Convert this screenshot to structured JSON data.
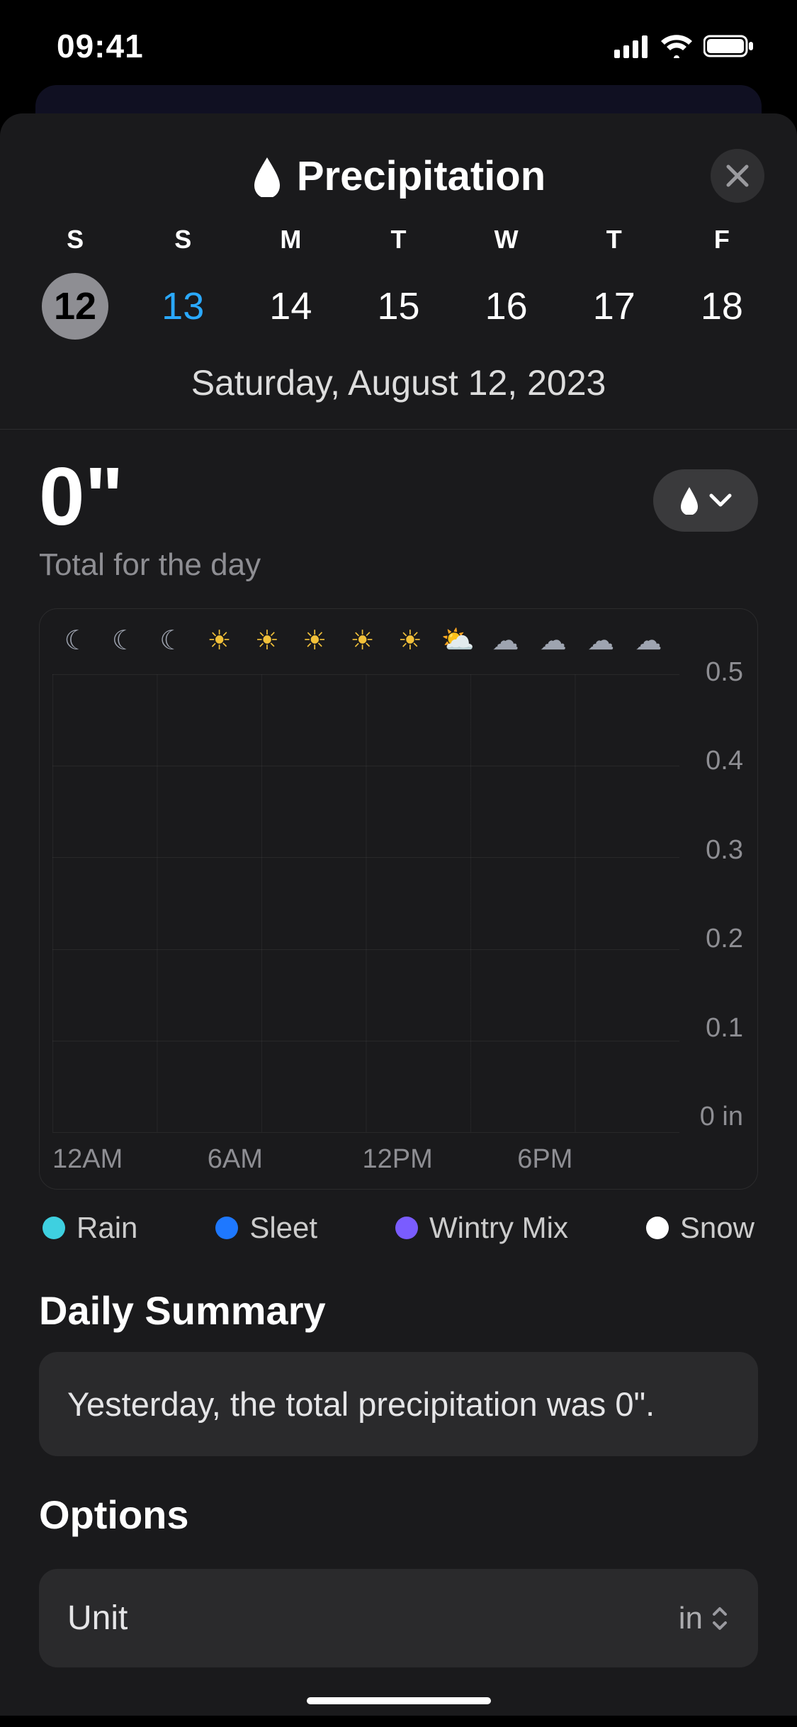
{
  "status": {
    "time": "09:41"
  },
  "header": {
    "title": "Precipitation"
  },
  "calendar": {
    "dow": [
      "S",
      "S",
      "M",
      "T",
      "W",
      "T",
      "F"
    ],
    "dates": [
      "12",
      "13",
      "14",
      "15",
      "16",
      "17",
      "18"
    ],
    "full_date": "Saturday, August 12, 2023"
  },
  "total": {
    "value": "0\"",
    "label": "Total for the day"
  },
  "chart_data": {
    "type": "bar",
    "x_hours": [
      0,
      1,
      2,
      3,
      4,
      5,
      6,
      7,
      8,
      9,
      10,
      11,
      12,
      13,
      14,
      15,
      16,
      17,
      18,
      19,
      20,
      21,
      22,
      23
    ],
    "values": [
      0,
      0,
      0,
      0,
      0,
      0,
      0,
      0,
      0,
      0,
      0,
      0,
      0,
      0,
      0,
      0,
      0,
      0,
      0,
      0,
      0,
      0,
      0,
      0
    ],
    "x_ticks": [
      "12AM",
      "6AM",
      "12PM",
      "6PM"
    ],
    "y_ticks": [
      "0.5",
      "0.4",
      "0.3",
      "0.2",
      "0.1",
      "0 in"
    ],
    "ylim": [
      0,
      0.5
    ],
    "ylabel": "in",
    "condition_icons": [
      "moon",
      "moon",
      "moon",
      "sun",
      "sun",
      "sun",
      "sun",
      "sun",
      "partly",
      "cloud",
      "cloud",
      "cloud",
      "cloud"
    ]
  },
  "legend": [
    {
      "name": "Rain",
      "color": "#3ed0e0"
    },
    {
      "name": "Sleet",
      "color": "#1e78ff"
    },
    {
      "name": "Wintry Mix",
      "color": "#7a5cff"
    },
    {
      "name": "Snow",
      "color": "#ffffff"
    }
  ],
  "summary": {
    "heading": "Daily Summary",
    "text": "Yesterday, the total precipitation was 0\"."
  },
  "options": {
    "heading": "Options",
    "unit_label": "Unit",
    "unit_value": "in"
  }
}
